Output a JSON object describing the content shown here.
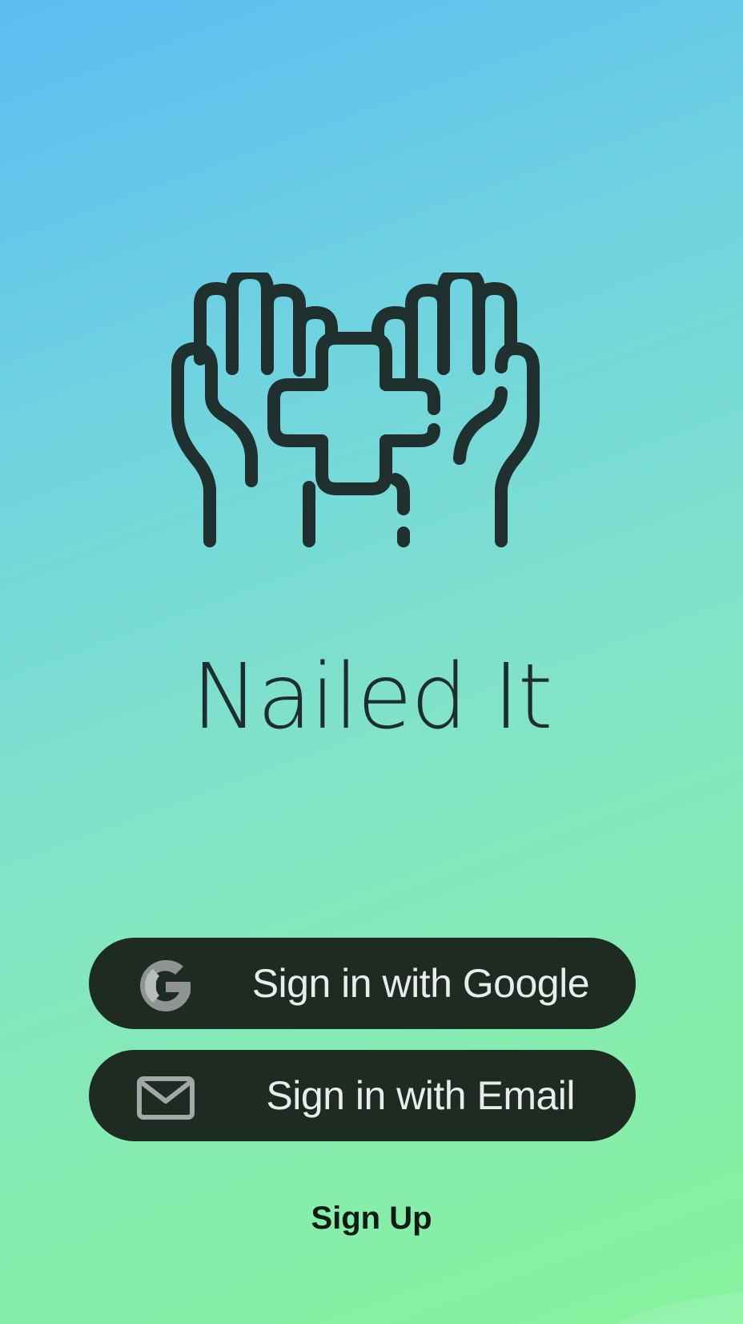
{
  "app": {
    "title": "Nailed It",
    "logo_icon": "hands-with-cross-icon"
  },
  "auth": {
    "google_button_label": "Sign in with Google",
    "google_icon": "google-g-icon",
    "email_button_label": "Sign in with Email",
    "email_icon": "envelope-icon",
    "signup_link_label": "Sign Up"
  },
  "colors": {
    "gradient_start": "#5bbcf2",
    "gradient_end": "#86f29c",
    "button_background": "#1d2b22",
    "button_text": "#e8ecea",
    "icon_dark": "#1e2e2c"
  }
}
